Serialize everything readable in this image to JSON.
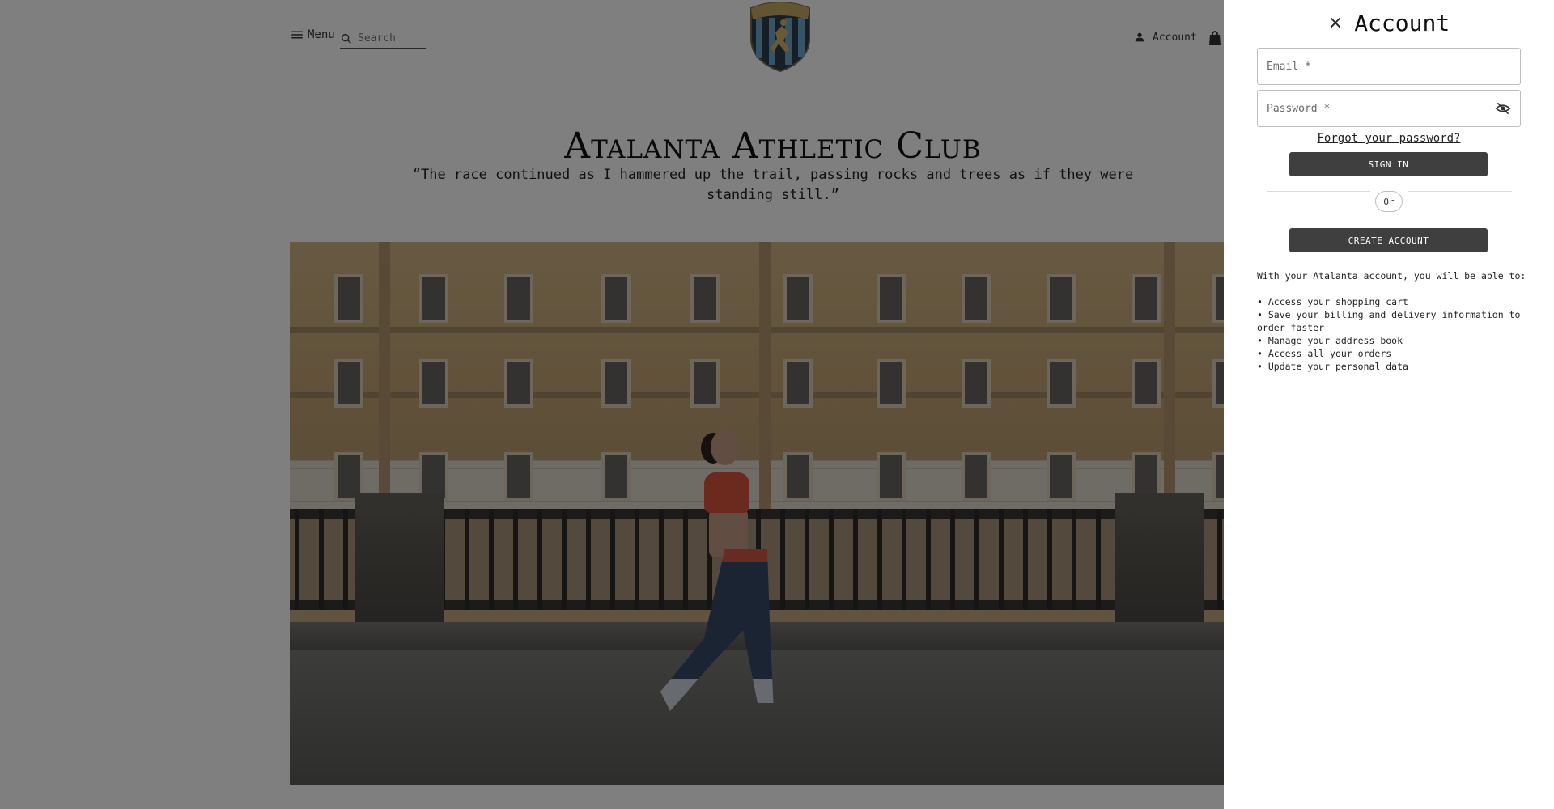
{
  "header": {
    "menu_label": "Menu",
    "search_placeholder": "Search",
    "logo_text": "ATALANTA",
    "account_label": "Account"
  },
  "hero": {
    "title": "Atalanta Athletic Club",
    "quote": "“The race continued as I hammered up the trail, passing rocks and trees as if they were standing still.”"
  },
  "drawer": {
    "title": "Account",
    "close_label": "×",
    "email_placeholder": "Email *",
    "password_placeholder": "Password *",
    "forgot_label": "Forgot your password?",
    "sign_in_label": "SIGN IN",
    "or_label": "Or",
    "create_account_label": "CREATE ACCOUNT",
    "benefits_intro": "With your Atalanta account, you will be able to:",
    "benefits": [
      "Access your shopping cart",
      "Save your billing and delivery information to order faster",
      "Manage your address book",
      "Access all your orders",
      "Update your personal data"
    ]
  },
  "colors": {
    "overlay": "rgba(0,0,0,0.5)",
    "button_dark": "#3f3f3f",
    "drawer_bg": "#ffffff"
  },
  "icons": [
    "menu-icon",
    "search-icon",
    "logo-crest",
    "user-icon",
    "shopping-bag-icon",
    "close-icon",
    "eye-off-icon"
  ]
}
